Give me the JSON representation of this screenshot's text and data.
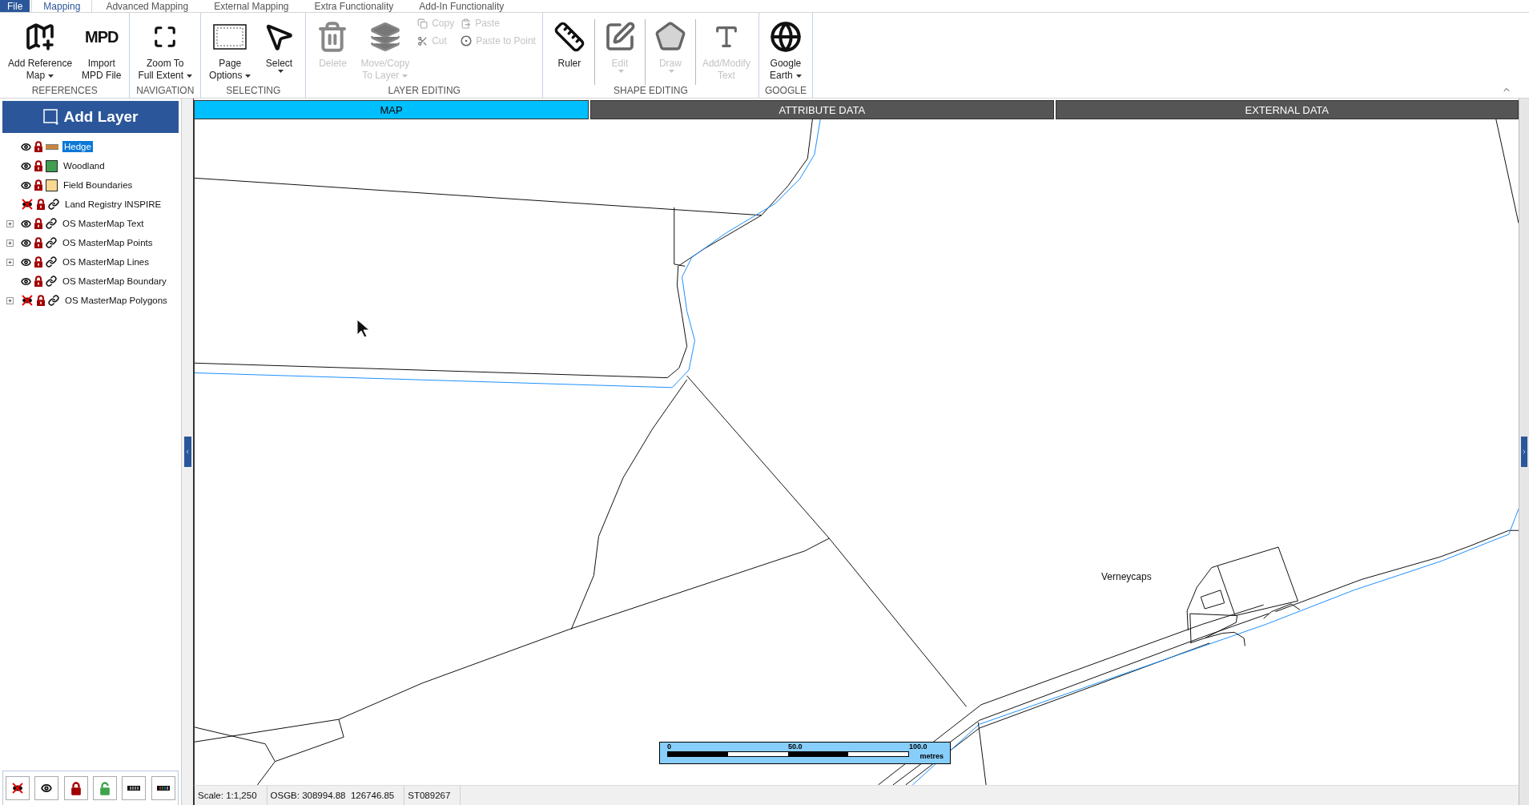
{
  "menu_tabs": [
    {
      "label": "File",
      "kind": "file",
      "selected": false
    },
    {
      "label": "Mapping",
      "kind": "tab",
      "selected": true
    },
    {
      "label": "Advanced Mapping",
      "kind": "tab",
      "selected": false
    },
    {
      "label": "External Mapping",
      "kind": "tab",
      "selected": false
    },
    {
      "label": "Extra Functionality",
      "kind": "tab",
      "selected": false
    },
    {
      "label": "Add-In Functionality",
      "kind": "tab",
      "selected": false
    }
  ],
  "ribbon": [
    {
      "label": "REFERENCES",
      "divided": false,
      "columns": [
        {
          "kind": "large",
          "buttons": [
            {
              "lines": [
                "Add Reference",
                "Map"
              ],
              "disabled": false,
              "dropdown": true
            }
          ]
        },
        {
          "kind": "large",
          "buttons": [
            {
              "lines": [
                "Import",
                "MPD File"
              ],
              "icon_text": "MPD",
              "disabled": false,
              "dropdown": false
            }
          ]
        }
      ]
    },
    {
      "label": "NAVIGATION",
      "divided": false,
      "columns": [
        {
          "kind": "large",
          "buttons": [
            {
              "lines": [
                "Zoom To",
                "Full Extent"
              ],
              "disabled": false,
              "dropdown": true
            }
          ]
        }
      ]
    },
    {
      "label": "SELECTING",
      "divided": false,
      "columns": [
        {
          "kind": "large",
          "buttons": [
            {
              "lines": [
                "Page",
                "Options"
              ],
              "disabled": false,
              "dropdown": true
            }
          ]
        },
        {
          "kind": "large",
          "buttons": [
            {
              "lines": [
                "Select"
              ],
              "disabled": false,
              "dropdown": true
            }
          ]
        }
      ]
    },
    {
      "label": "LAYER EDITING",
      "divided": false,
      "columns": [
        {
          "kind": "large",
          "buttons": [
            {
              "lines": [
                "Delete"
              ],
              "disabled": true,
              "dropdown": false
            }
          ]
        },
        {
          "kind": "large",
          "buttons": [
            {
              "lines": [
                "Move/Copy",
                "To Layer"
              ],
              "disabled": true,
              "dropdown": true
            }
          ]
        },
        {
          "kind": "small",
          "buttons": [
            {
              "lines": [
                "Copy"
              ],
              "disabled": true
            },
            {
              "lines": [
                "Cut"
              ],
              "disabled": true
            }
          ]
        },
        {
          "kind": "small",
          "buttons": [
            {
              "lines": [
                "Paste"
              ],
              "disabled": true
            },
            {
              "lines": [
                "Paste to Point"
              ],
              "disabled": true
            }
          ]
        }
      ]
    },
    {
      "label": "SHAPE EDITING",
      "divided": true,
      "columns": [
        {
          "kind": "large",
          "buttons": [
            {
              "lines": [
                "Ruler"
              ],
              "disabled": false,
              "dropdown": false
            }
          ]
        },
        {
          "kind": "large",
          "buttons": [
            {
              "lines": [
                "Edit"
              ],
              "disabled": true,
              "dropdown": true
            }
          ]
        },
        {
          "kind": "large",
          "buttons": [
            {
              "lines": [
                "Draw"
              ],
              "disabled": true,
              "dropdown": true
            }
          ]
        },
        {
          "kind": "large",
          "buttons": [
            {
              "lines": [
                "Add/Modify",
                "Text"
              ],
              "disabled": true,
              "dropdown": false
            }
          ]
        }
      ]
    },
    {
      "label": "GOOGLE",
      "divided": false,
      "columns": [
        {
          "kind": "large",
          "buttons": [
            {
              "lines": [
                "Google",
                "Earth"
              ],
              "disabled": false,
              "dropdown": true
            }
          ]
        }
      ]
    }
  ],
  "layer_panel": {
    "title": "Add Layer",
    "layers": [
      {
        "name": "Hedge",
        "visible": true,
        "locked": true,
        "kind": "line",
        "color": "#c8843c",
        "selected": true
      },
      {
        "name": "Woodland",
        "visible": true,
        "locked": true,
        "kind": "fill",
        "color": "#3f9e50",
        "selected": false
      },
      {
        "name": "Field Boundaries",
        "visible": true,
        "locked": true,
        "kind": "fill",
        "color": "#f8d890",
        "selected": false
      },
      {
        "name": "Land Registry INSPIRE",
        "visible": false,
        "locked": true,
        "kind": "link",
        "selected": false
      },
      {
        "name": "OS MasterMap Text",
        "visible": true,
        "locked": true,
        "kind": "link",
        "expanded": false,
        "selected": false
      },
      {
        "name": "OS MasterMap Points",
        "visible": true,
        "locked": true,
        "kind": "link",
        "expanded": false,
        "selected": false
      },
      {
        "name": "OS MasterMap Lines",
        "visible": true,
        "locked": true,
        "kind": "link",
        "expanded": false,
        "selected": false
      },
      {
        "name": "OS MasterMap Boundary",
        "visible": true,
        "locked": true,
        "kind": "link",
        "selected": false
      },
      {
        "name": "OS MasterMap Polygons",
        "visible": false,
        "locked": true,
        "kind": "link",
        "expanded": false,
        "selected": false
      }
    ]
  },
  "view_tabs": [
    {
      "label": "MAP",
      "selected": true
    },
    {
      "label": "ATTRIBUTE DATA",
      "selected": false
    },
    {
      "label": "EXTERNAL DATA",
      "selected": false
    }
  ],
  "map": {
    "place_labels": [
      "Verneycaps"
    ],
    "scale_bar": {
      "ticks": [
        "0",
        "50.0",
        "100.0"
      ],
      "unit": "metres"
    }
  },
  "status_bar": [
    "Scale: 1:1,250",
    "OSGB: 308994.88  126746.85",
    "ST089267"
  ]
}
